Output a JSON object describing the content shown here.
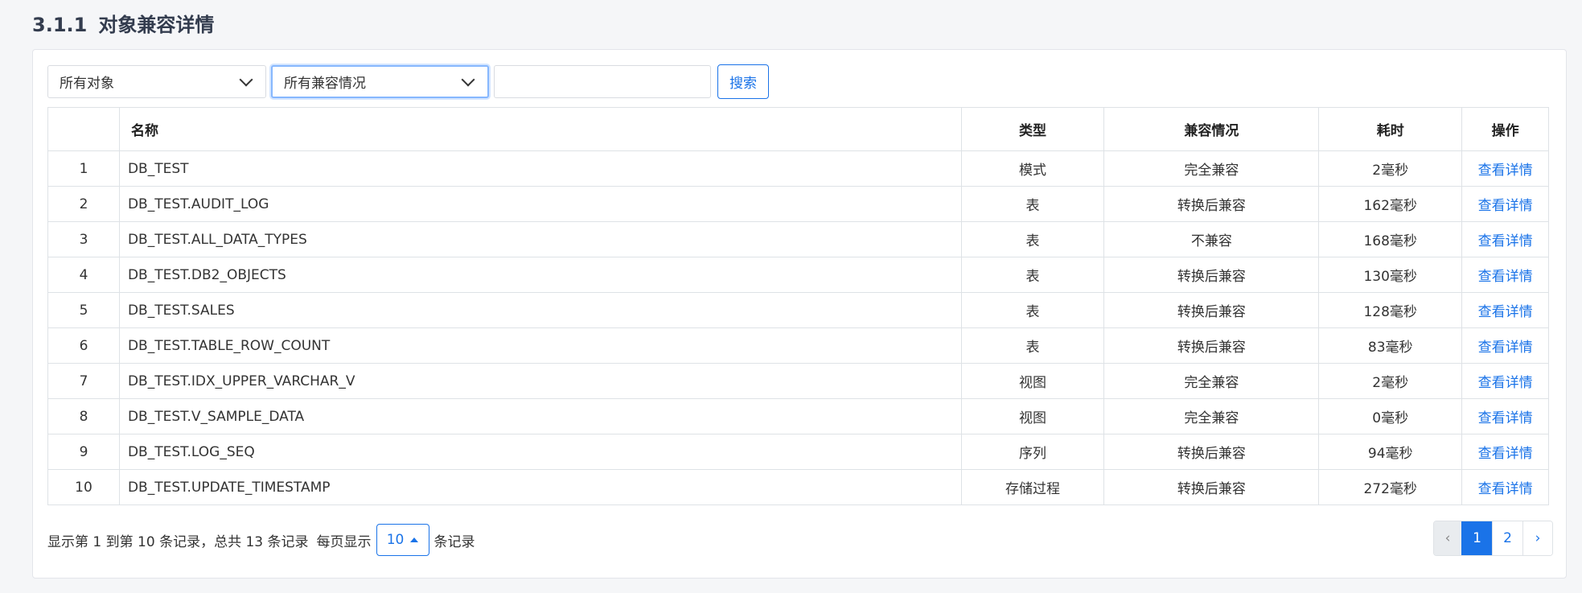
{
  "section": {
    "number": "3.1.1",
    "title": "对象兼容详情"
  },
  "toolbar": {
    "object_filter": "所有对象",
    "compat_filter": "所有兼容情况",
    "search_value": "",
    "search_placeholder": "",
    "search_label": "搜索"
  },
  "table": {
    "headers": {
      "index": "",
      "name": "名称",
      "type": "类型",
      "compat": "兼容情况",
      "time": "耗时",
      "action": "操作"
    },
    "rows": [
      {
        "idx": "1",
        "name": "DB_TEST",
        "type": "模式",
        "compat": "完全兼容",
        "status": "full",
        "time": "2毫秒",
        "action": "查看详情"
      },
      {
        "idx": "2",
        "name": "DB_TEST.AUDIT_LOG",
        "type": "表",
        "compat": "转换后兼容",
        "status": "convert",
        "time": "162毫秒",
        "action": "查看详情"
      },
      {
        "idx": "3",
        "name": "DB_TEST.ALL_DATA_TYPES",
        "type": "表",
        "compat": "不兼容",
        "status": "none",
        "time": "168毫秒",
        "action": "查看详情"
      },
      {
        "idx": "4",
        "name": "DB_TEST.DB2_OBJECTS",
        "type": "表",
        "compat": "转换后兼容",
        "status": "convert",
        "time": "130毫秒",
        "action": "查看详情"
      },
      {
        "idx": "5",
        "name": "DB_TEST.SALES",
        "type": "表",
        "compat": "转换后兼容",
        "status": "convert",
        "time": "128毫秒",
        "action": "查看详情"
      },
      {
        "idx": "6",
        "name": "DB_TEST.TABLE_ROW_COUNT",
        "type": "表",
        "compat": "转换后兼容",
        "status": "convert",
        "time": "83毫秒",
        "action": "查看详情"
      },
      {
        "idx": "7",
        "name": "DB_TEST.IDX_UPPER_VARCHAR_V",
        "type": "视图",
        "compat": "完全兼容",
        "status": "full",
        "time": "2毫秒",
        "action": "查看详情"
      },
      {
        "idx": "8",
        "name": "DB_TEST.V_SAMPLE_DATA",
        "type": "视图",
        "compat": "完全兼容",
        "status": "full",
        "time": "0毫秒",
        "action": "查看详情"
      },
      {
        "idx": "9",
        "name": "DB_TEST.LOG_SEQ",
        "type": "序列",
        "compat": "转换后兼容",
        "status": "convert",
        "time": "94毫秒",
        "action": "查看详情"
      },
      {
        "idx": "10",
        "name": "DB_TEST.UPDATE_TIMESTAMP",
        "type": "存储过程",
        "compat": "转换后兼容",
        "status": "convert",
        "time": "272毫秒",
        "action": "查看详情"
      }
    ]
  },
  "footer": {
    "summary": "显示第 1 到第 10 条记录，总共 13 条记录",
    "per_page_prefix": "每页显示",
    "per_page_value": "10",
    "per_page_suffix": "条记录"
  },
  "pagination": {
    "prev": "‹",
    "pages": [
      "1",
      "2"
    ],
    "active_page": "1",
    "next": "›"
  },
  "colors": {
    "full": "#4caf50",
    "convert": "#f0a04b",
    "none": "#e53935",
    "link": "#1a73e8"
  },
  "icons": {
    "select_arrow": "chevron-down-icon",
    "page_size_arrow": "caret-up-icon",
    "prev": "chevron-left-icon",
    "next": "chevron-right-icon"
  }
}
